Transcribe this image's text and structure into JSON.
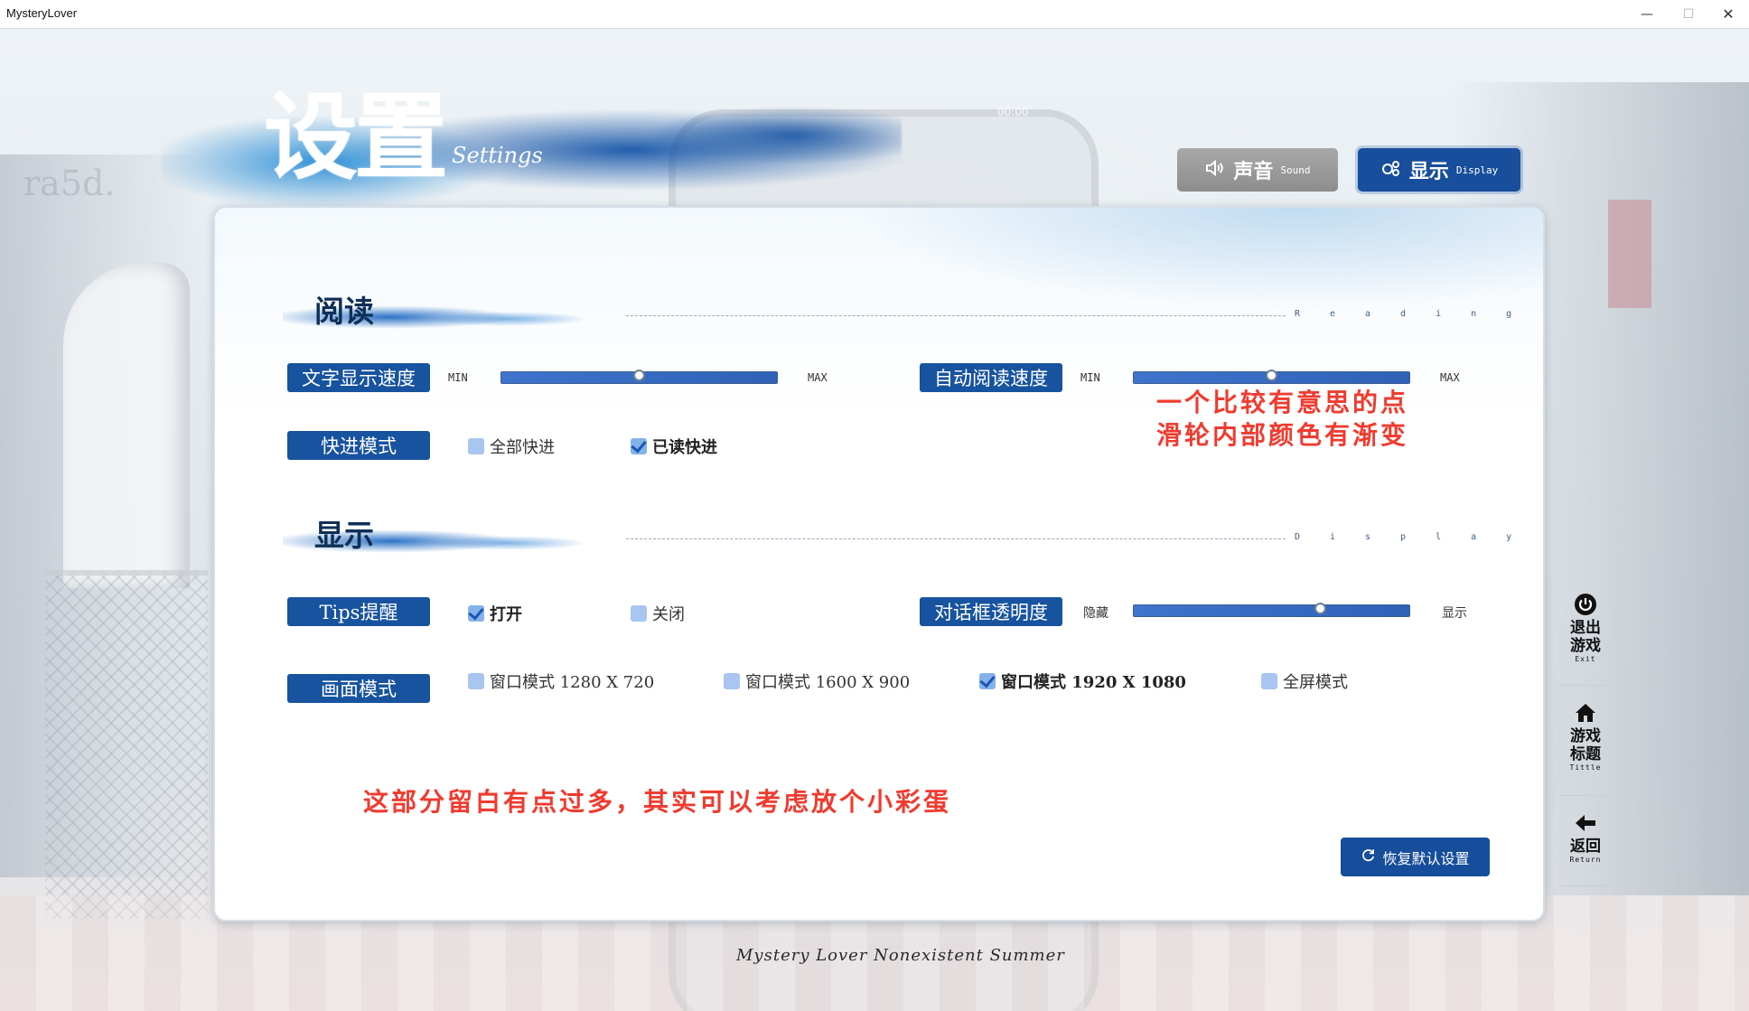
{
  "window": {
    "title": "MysteryLover",
    "minimize": "—",
    "maximize": "☐",
    "close": "✕"
  },
  "background": {
    "time": "00:00",
    "ghost_text": "ra5d."
  },
  "header": {
    "title_cn": "设置",
    "title_en": "Settings"
  },
  "tabs": [
    {
      "label": "声音",
      "sub": "Sound",
      "active": false
    },
    {
      "label": "显示",
      "sub": "Display",
      "active": true
    }
  ],
  "reading": {
    "title": "阅读",
    "en": "Reading",
    "text_speed": {
      "label": "文字显示速度",
      "min": "MIN",
      "max": "MAX",
      "value": 0.5
    },
    "auto_speed": {
      "label": "自动阅读速度",
      "min": "MIN",
      "max": "MAX",
      "value": 0.5
    },
    "skip": {
      "label": "快进模式",
      "options": [
        {
          "text": "全部快进",
          "checked": false
        },
        {
          "text": "已读快进",
          "checked": true
        }
      ]
    }
  },
  "display": {
    "title": "显示",
    "en": "Display",
    "tips": {
      "label": "Tips提醒",
      "options": [
        {
          "text": "打开",
          "checked": true
        },
        {
          "text": "关闭",
          "checked": false
        }
      ]
    },
    "opacity": {
      "label": "对话框透明度",
      "min": "隐藏",
      "max": "显示",
      "value": 0.68
    },
    "screen": {
      "label": "画面模式",
      "options": [
        {
          "text": "窗口模式 1280 X 720",
          "checked": false
        },
        {
          "text": "窗口模式 1600 X 900",
          "checked": false
        },
        {
          "text": "窗口模式 1920 X 1080",
          "checked": true
        },
        {
          "text": "全屏模式",
          "checked": false
        }
      ]
    }
  },
  "annotations": {
    "slider_note_line1": "一个比较有意思的点",
    "slider_note_line2": "滑轮内部颜色有渐变",
    "whitespace_note": "这部分留白有点过多，其实可以考虑放个小彩蛋"
  },
  "reset_button": "恢复默认设置",
  "side_nav": [
    {
      "cn1": "退出",
      "cn2": "游戏",
      "en": "Exit",
      "icon": "power-icon"
    },
    {
      "cn1": "游戏",
      "cn2": "标题",
      "en": "Tittle",
      "icon": "home-icon"
    },
    {
      "cn1": "返回",
      "cn2": "",
      "en": "Return",
      "icon": "arrow-left-icon"
    }
  ],
  "footer": "Mystery Lover Nonexistent Summer",
  "colors": {
    "accent": "#17539f",
    "note": "#f03b2f",
    "tab_inactive": "#9a9a9a"
  }
}
